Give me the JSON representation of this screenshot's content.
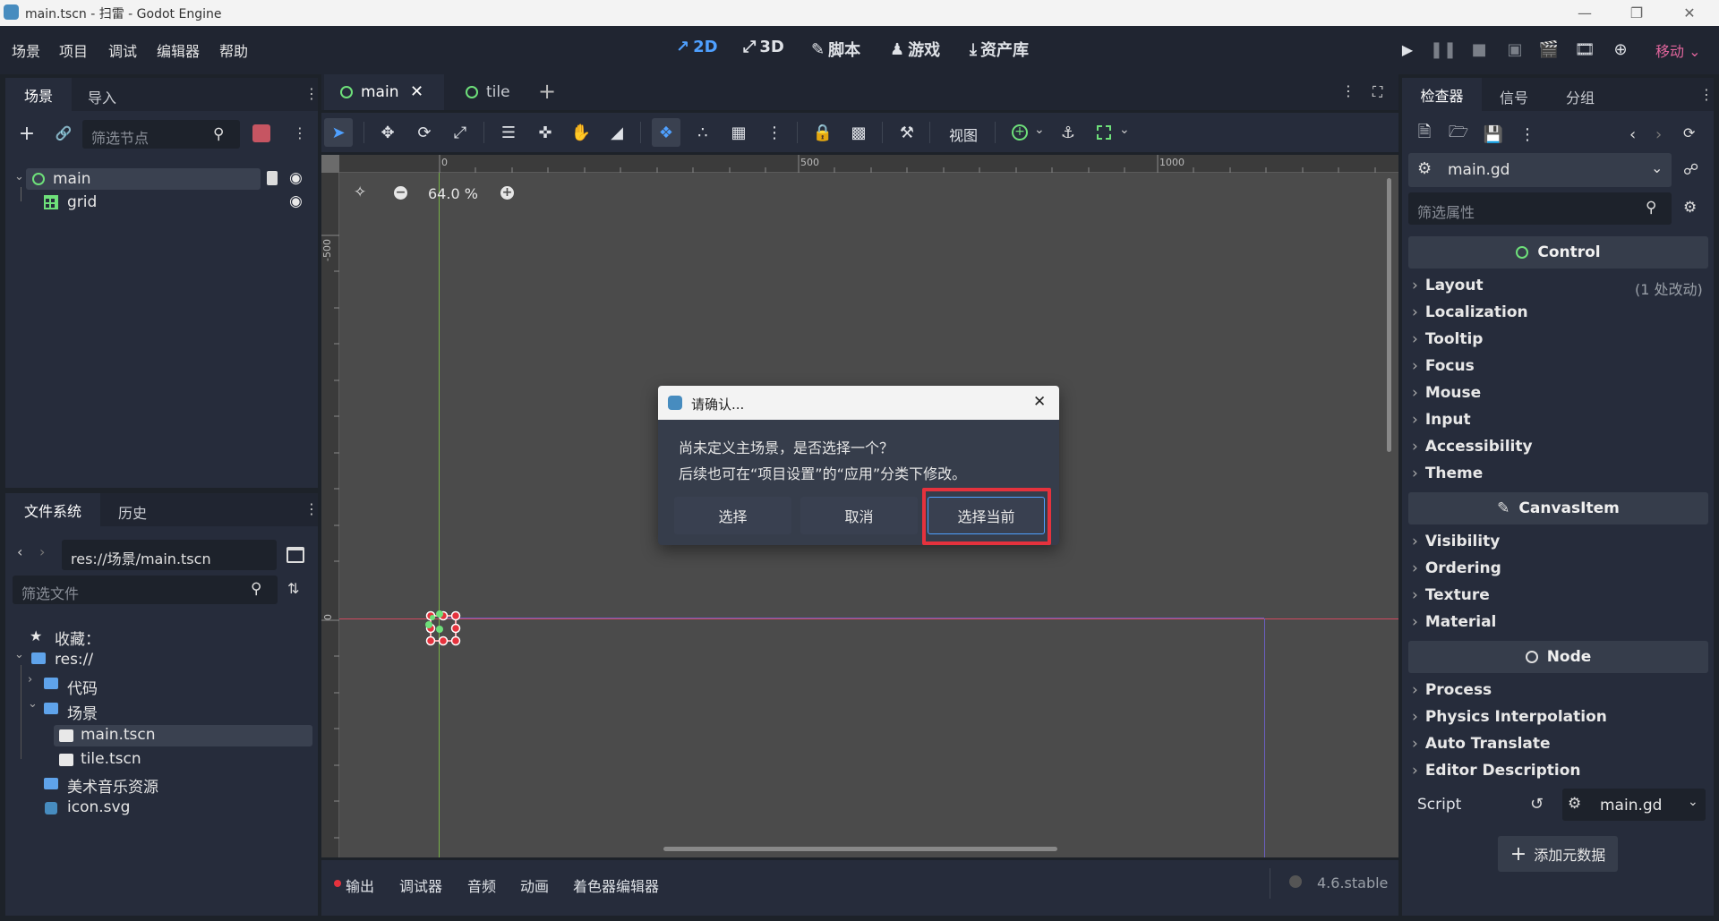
{
  "titlebar": {
    "title": "main.tscn - 扫雷 - Godot Engine"
  },
  "menu": [
    "场景",
    "项目",
    "调试",
    "编辑器",
    "帮助"
  ],
  "workspaces": {
    "w2d": "2D",
    "w3d": "3D",
    "script": "脚本",
    "game": "游戏",
    "assetlib": "资产库"
  },
  "renderer": "移动",
  "scene_dock": {
    "tabs": [
      "场景",
      "导入"
    ],
    "filter_placeholder": "筛选节点",
    "nodes": [
      "main",
      "grid"
    ]
  },
  "filesystem_dock": {
    "tabs": [
      "文件系统",
      "历史"
    ],
    "path": "res://场景/main.tscn",
    "filter_placeholder": "筛选文件",
    "items": [
      "收藏：",
      "res://",
      "代码",
      "场景",
      "main.tscn",
      "tile.tscn",
      "美术音乐资源",
      "icon.svg"
    ]
  },
  "editor_tabs": [
    "main",
    "tile"
  ],
  "toolbar": {
    "view_label": "视图"
  },
  "viewport": {
    "zoom": "64.0 %",
    "ruler_h": [
      "0",
      "500",
      "1000"
    ],
    "ruler_v": [
      "-500",
      "0"
    ]
  },
  "dialog": {
    "title": "请确认...",
    "line1": "尚未定义主场景，是否选择一个？",
    "line2": "后续也可在“项目设置”的“应用”分类下修改。",
    "btn_select": "选择",
    "btn_cancel": "取消",
    "btn_select_current": "选择当前"
  },
  "bottom_panel": {
    "items": [
      "输出",
      "调试器",
      "音频",
      "动画",
      "着色器编辑器"
    ],
    "version": "4.6.stable"
  },
  "inspector": {
    "tabs": [
      "检查器",
      "信号",
      "分组"
    ],
    "resource": "main.gd",
    "filter_placeholder": "筛选属性",
    "control_header": "Control",
    "control_props": [
      "Layout",
      "Localization",
      "Tooltip",
      "Focus",
      "Mouse",
      "Input",
      "Accessibility",
      "Theme"
    ],
    "layout_changes": "(1 处改动)",
    "canvasitem_header": "CanvasItem",
    "canvasitem_props": [
      "Visibility",
      "Ordering",
      "Texture",
      "Material"
    ],
    "node_header": "Node",
    "node_props": [
      "Process",
      "Physics Interpolation",
      "Auto Translate",
      "Editor Description"
    ],
    "script_label": "Script",
    "script_value": "main.gd",
    "add_metadata": "添加元数据"
  },
  "colors": {
    "accent": "#4fa0ff",
    "highlight_box": "#e5323d",
    "node_green": "#6ee07a",
    "renderer": "#e0659c"
  }
}
